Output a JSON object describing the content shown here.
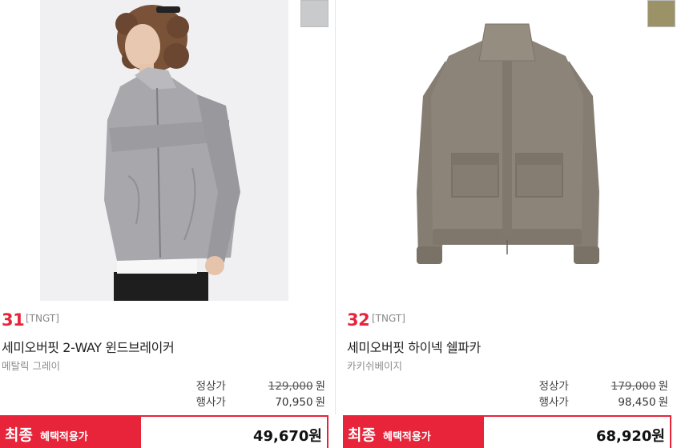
{
  "colors": {
    "accent": "#e8243a",
    "swatch_gray": "#c8cacc",
    "swatch_khaki": "#9c9268"
  },
  "products": [
    {
      "rank": "31",
      "brand": "[TNGT]",
      "name": "세미오버핏 2-WAY 윈드브레이커",
      "color": "메탈릭 그레이",
      "regular_label": "정상가",
      "regular_price": "129,000",
      "event_label": "행사가",
      "event_price": "70,950",
      "won": "원",
      "final_label_big": "최종",
      "final_label_small": "혜택적용가",
      "final_price": "49,670원"
    },
    {
      "rank": "32",
      "brand": "[TNGT]",
      "name": "세미오버핏 하이넥 쉘파카",
      "color": "카키쉬베이지",
      "regular_label": "정상가",
      "regular_price": "179,000",
      "event_label": "행사가",
      "event_price": "98,450",
      "won": "원",
      "final_label_big": "최종",
      "final_label_small": "혜택적용가",
      "final_price": "68,920원"
    }
  ]
}
